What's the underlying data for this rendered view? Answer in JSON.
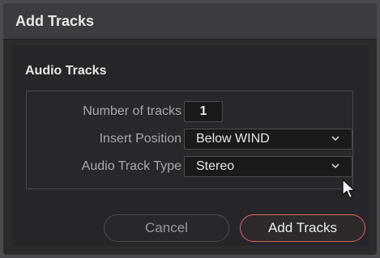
{
  "window": {
    "title": "Add Tracks"
  },
  "section": {
    "title": "Audio Tracks"
  },
  "fields": {
    "number_of_tracks": {
      "label": "Number of tracks",
      "value": "1"
    },
    "insert_position": {
      "label": "Insert Position",
      "value": "Below WIND"
    },
    "audio_track_type": {
      "label": "Audio Track Type",
      "value": "Stereo"
    }
  },
  "buttons": {
    "cancel": "Cancel",
    "add_tracks": "Add Tracks"
  },
  "icons": {
    "dropdown": "chevron-down-icon",
    "cursor": "mouse-pointer-icon"
  },
  "colors": {
    "accent": "#e0625a",
    "dialog_bg": "#2b2b2e",
    "titlebar_bg": "#3c3c40"
  }
}
